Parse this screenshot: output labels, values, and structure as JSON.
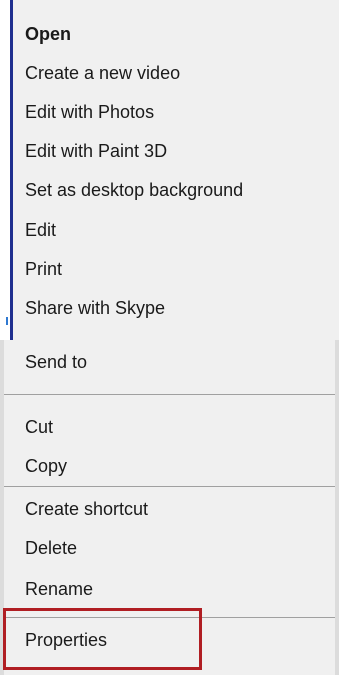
{
  "context_menu": {
    "top_items": [
      {
        "label": "Open"
      },
      {
        "label": "Create a new video"
      },
      {
        "label": "Edit with Photos"
      },
      {
        "label": "Edit with Paint 3D"
      },
      {
        "label": "Set as desktop background"
      },
      {
        "label": "Edit"
      },
      {
        "label": "Print"
      },
      {
        "label": "Share with Skype"
      }
    ],
    "bottom_items": [
      {
        "label": "Send to"
      },
      {
        "label": "Cut"
      },
      {
        "label": "Copy"
      },
      {
        "label": "Create shortcut"
      },
      {
        "label": "Delete"
      },
      {
        "label": "Rename"
      },
      {
        "label": "Properties"
      }
    ]
  },
  "colors": {
    "menu_background": "#f0f0f0",
    "left_accent": "#1f2f8f",
    "separator": "#a0a0a0",
    "highlight_box": "#b01e23"
  }
}
